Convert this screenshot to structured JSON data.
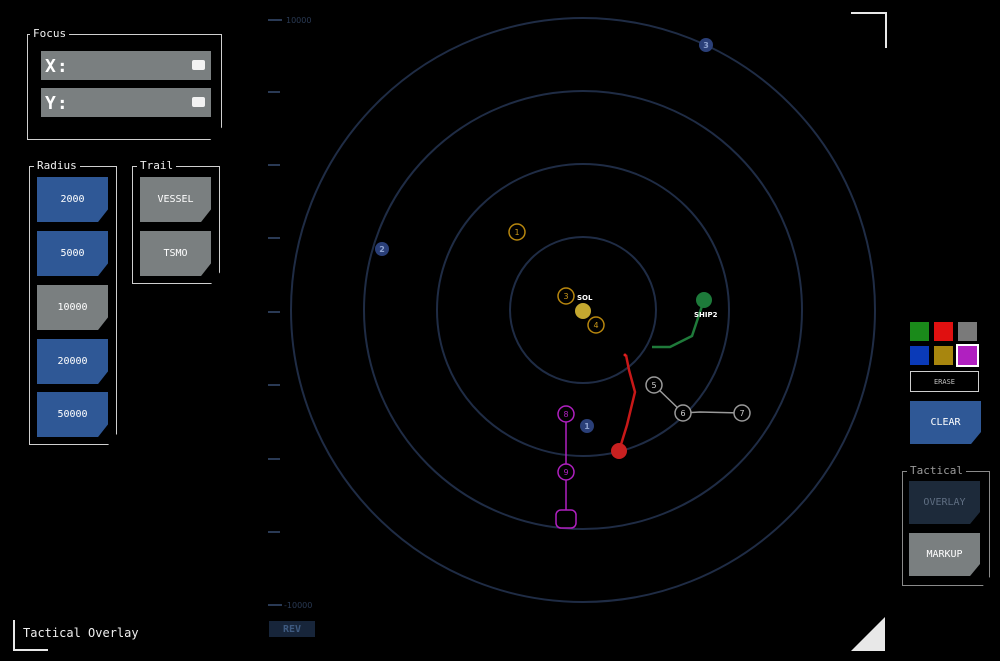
{
  "focus": {
    "legend": "Focus",
    "x_label": "X:",
    "x_value": "",
    "y_label": "Y:",
    "y_value": ""
  },
  "radius": {
    "legend": "Radius",
    "options": [
      "2000",
      "5000",
      "10000",
      "20000",
      "50000"
    ],
    "selected": "10000"
  },
  "trail": {
    "legend": "Trail",
    "options": [
      "VESSEL",
      "TSMO"
    ]
  },
  "palette": {
    "colors": [
      "#1a8a1a",
      "#e01010",
      "#7a7a7a",
      "#0a3ab8",
      "#a8860e",
      "#b020c0"
    ],
    "selected": "#b020c0",
    "erase_label": "ERASE",
    "clear_label": "CLEAR"
  },
  "tactical": {
    "legend": "Tactical",
    "overlay_label": "OVERLAY",
    "markup_label": "MARKUP"
  },
  "scale": {
    "top_label": "10000",
    "bottom_label": "-10000"
  },
  "rev_label": "REV",
  "footer_title": "Tactical Overlay",
  "map": {
    "sol_label": "SOL",
    "ship2_label": "SHIP2",
    "gold_markers": [
      "1",
      "3",
      "4"
    ],
    "blue_markers": [
      "2",
      "3",
      "1"
    ],
    "gray_markers": [
      "5",
      "6",
      "7"
    ],
    "magenta_markers": [
      "8",
      "9"
    ]
  }
}
